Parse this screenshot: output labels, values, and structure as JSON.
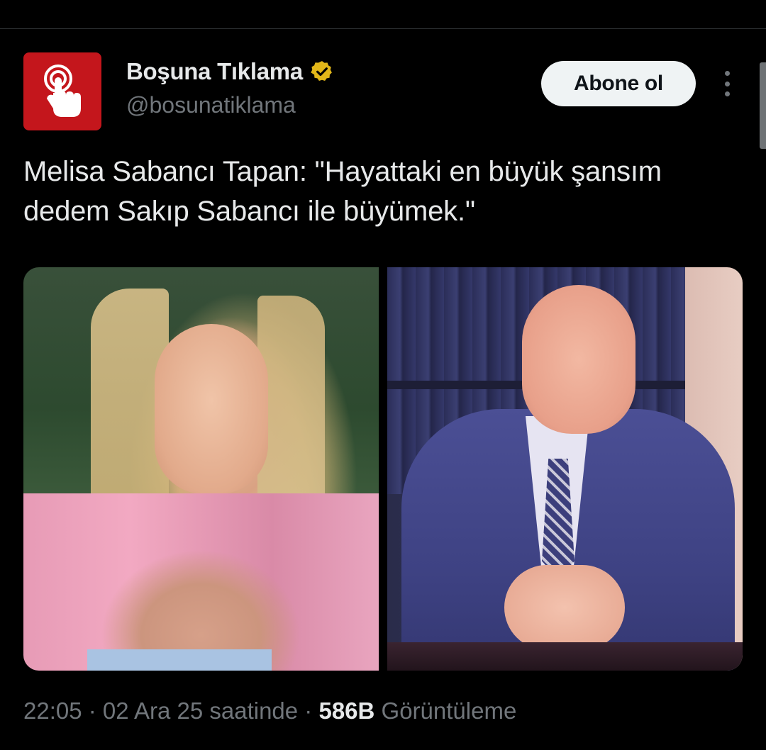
{
  "account": {
    "display_name": "Boşuna Tıklama",
    "handle": "@bosunatiklama",
    "avatar_color": "#c4161c",
    "verified_badge_color": "#e2b719"
  },
  "actions": {
    "subscribe_label": "Abone ol",
    "more_icon": "more-vertical-icon"
  },
  "tweet": {
    "text": "Melisa Sabancı Tapan: \"Hayattaki en büyük şansım dedem Sakıp Sabancı ile büyümek.\""
  },
  "media": {
    "count": 2
  },
  "meta": {
    "time": "22:05",
    "separator": " · ",
    "date": "02 Ara 25 saatinde",
    "views_count": "586B",
    "views_label": "Görüntüleme"
  }
}
